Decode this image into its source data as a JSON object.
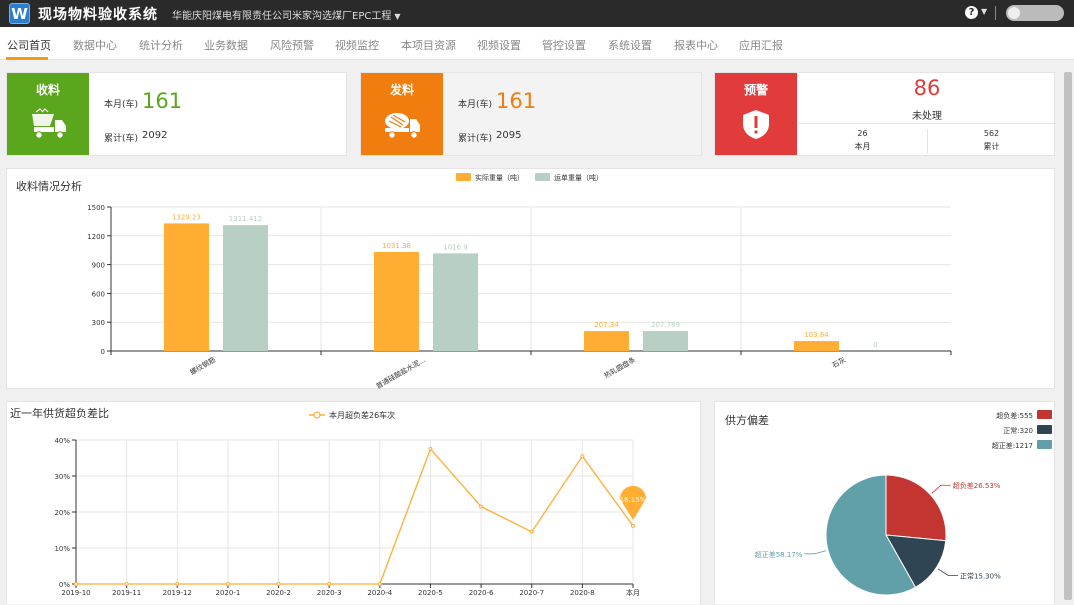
{
  "header": {
    "logo_letter": "W",
    "app_title": "现场物料验收系统",
    "project": "华能庆阳煤电有限责任公司米家沟选煤厂EPC工程",
    "help_icon": "?"
  },
  "nav": {
    "tabs": [
      {
        "label": "公司首页",
        "active": true
      },
      {
        "label": "数据中心"
      },
      {
        "label": "统计分析"
      },
      {
        "label": "业务数据"
      },
      {
        "label": "风险预警"
      },
      {
        "label": "视频监控"
      },
      {
        "label": "本项目资源"
      },
      {
        "label": "视频设置"
      },
      {
        "label": "管控设置"
      },
      {
        "label": "系统设置"
      },
      {
        "label": "报表中心"
      },
      {
        "label": "应用汇报"
      }
    ]
  },
  "receive": {
    "label": "收料",
    "icon": "dump-truck-icon",
    "month_label": "本月(车)",
    "month_value": "161",
    "total_label": "累计(车)",
    "total_value": "2092",
    "color": "#5aa61c"
  },
  "dispatch": {
    "label": "发料",
    "icon": "mixer-truck-icon",
    "month_label": "本月(车)",
    "month_value": "161",
    "total_label": "累计(车)",
    "total_value": "2095",
    "color": "#f07d0e"
  },
  "warning": {
    "label": "预警",
    "icon": "shield-alert-icon",
    "value": "86",
    "value_label": "未处理",
    "month_value": "26",
    "month_label": "本月",
    "total_value": "562",
    "total_label": "累计",
    "color": "#e23b3b"
  },
  "bar_panel": {
    "title": "收料情况分析"
  },
  "line_panel": {
    "title": "近一年供货超负差比"
  },
  "pie_panel": {
    "title": "供方偏差"
  },
  "chart_data": [
    {
      "type": "bar",
      "categories": [
        "螺纹钢筋",
        "普通硅酸盐水泥...",
        "热轧圆盘条",
        "石灰"
      ],
      "series": [
        {
          "name": "实际重量（吨）",
          "values": [
            1329.23,
            1031.38,
            207.34,
            103.64
          ],
          "labels": [
            "1329.23",
            "1031.38",
            "207.34",
            "103.64"
          ],
          "color": "#ffad33"
        },
        {
          "name": "运单重量（吨）",
          "values": [
            1311.412,
            1016.9,
            207.789,
            0
          ],
          "labels": [
            "1311.412",
            "1016.9",
            "207.789",
            "0"
          ],
          "color": "#b8d0c3"
        }
      ],
      "yticks": [
        "0",
        "300",
        "600",
        "900",
        "1200",
        "1500"
      ],
      "ylim": [
        0,
        1500
      ],
      "grid": true,
      "legend": "top-center"
    },
    {
      "type": "line",
      "categories": [
        "2019-10",
        "2019-11",
        "2019-12",
        "2020-1",
        "2020-2",
        "2020-3",
        "2020-4",
        "2020-5",
        "2020-6",
        "2020-7",
        "2020-8",
        "本月"
      ],
      "series": [
        {
          "name": "本月超负差26车次",
          "values": [
            0,
            0,
            0,
            0,
            0,
            0,
            0,
            37.5,
            21.5,
            14.5,
            35.5,
            16.15
          ],
          "color": "#ffad33"
        }
      ],
      "yticks": [
        "0%",
        "10%",
        "20%",
        "30%",
        "40%"
      ],
      "ylim": [
        0,
        40
      ],
      "marker_label": "16.15%",
      "grid": true,
      "legend": "top-center"
    },
    {
      "type": "pie",
      "series": [
        {
          "name": "超负差",
          "value": 555,
          "legend": "超负差:555",
          "label": "超负差26.53%",
          "color": "#c23531"
        },
        {
          "name": "正常",
          "value": 320,
          "legend": "正常:320",
          "label": "正常15.30%",
          "color": "#2f4554"
        },
        {
          "name": "超正差",
          "value": 1217,
          "legend": "超正差:1217",
          "label": "超正差58.17%",
          "color": "#61a0a8"
        }
      ],
      "legend": "top-right"
    }
  ]
}
